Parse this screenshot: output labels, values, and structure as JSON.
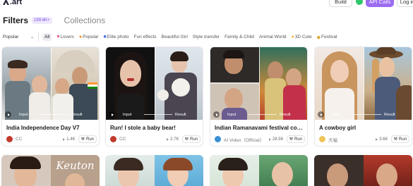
{
  "app": {
    "logo_text": ".art"
  },
  "header": {
    "build_label": "Build",
    "api_label": "API Calls",
    "login_label": "Log in"
  },
  "tabs": {
    "filters_label": "Filters",
    "filters_count": "199.6K+",
    "collections_label": "Collections"
  },
  "sort": {
    "selected": "Popular"
  },
  "chips": [
    {
      "label": "All",
      "active": true
    },
    {
      "label": "Lovers",
      "icon": "heart-icon",
      "icon_color": "#e0457b"
    },
    {
      "label": "Popular",
      "icon": "fire-icon",
      "icon_color": "#f08a24"
    },
    {
      "label": "Elite photo",
      "icon": "photo-icon",
      "icon_color": "#4d74e6"
    },
    {
      "label": "Fun effects"
    },
    {
      "label": "Beautiful Girl"
    },
    {
      "label": "Style transfer"
    },
    {
      "label": "Family & Child"
    },
    {
      "label": "Animal World"
    },
    {
      "label": "3D Cute",
      "icon": "emoji-icon",
      "icon_color": "#f2b33a"
    },
    {
      "label": "Festival",
      "icon": "festival-icon",
      "icon_color": "#d9a52a"
    }
  ],
  "cards": [
    {
      "title": "India Independence Day V7",
      "author": "CC",
      "uses": "1.4K",
      "run": "Run",
      "input_label": "Input",
      "result_label": "Result"
    },
    {
      "title": "Run! I stole a baby bear!",
      "author": "CC",
      "uses": "2.7K",
      "run": "Run",
      "input_label": "Input",
      "result_label": "Result"
    },
    {
      "title": "Indian Ramanavami festival coup...",
      "author": "AI Video（Official）",
      "uses": "28.5K",
      "run": "Run",
      "input_label": "Input",
      "result_label": "Result"
    },
    {
      "title": "A cowboy girl",
      "author": "大福",
      "uses": "3.6K",
      "run": "Run",
      "input_label": "Input",
      "result_label": "Result"
    }
  ],
  "second_row_text": "Keuton",
  "colors": {
    "accent": "#9b6bf2",
    "chat_green": "#2fc76a"
  }
}
